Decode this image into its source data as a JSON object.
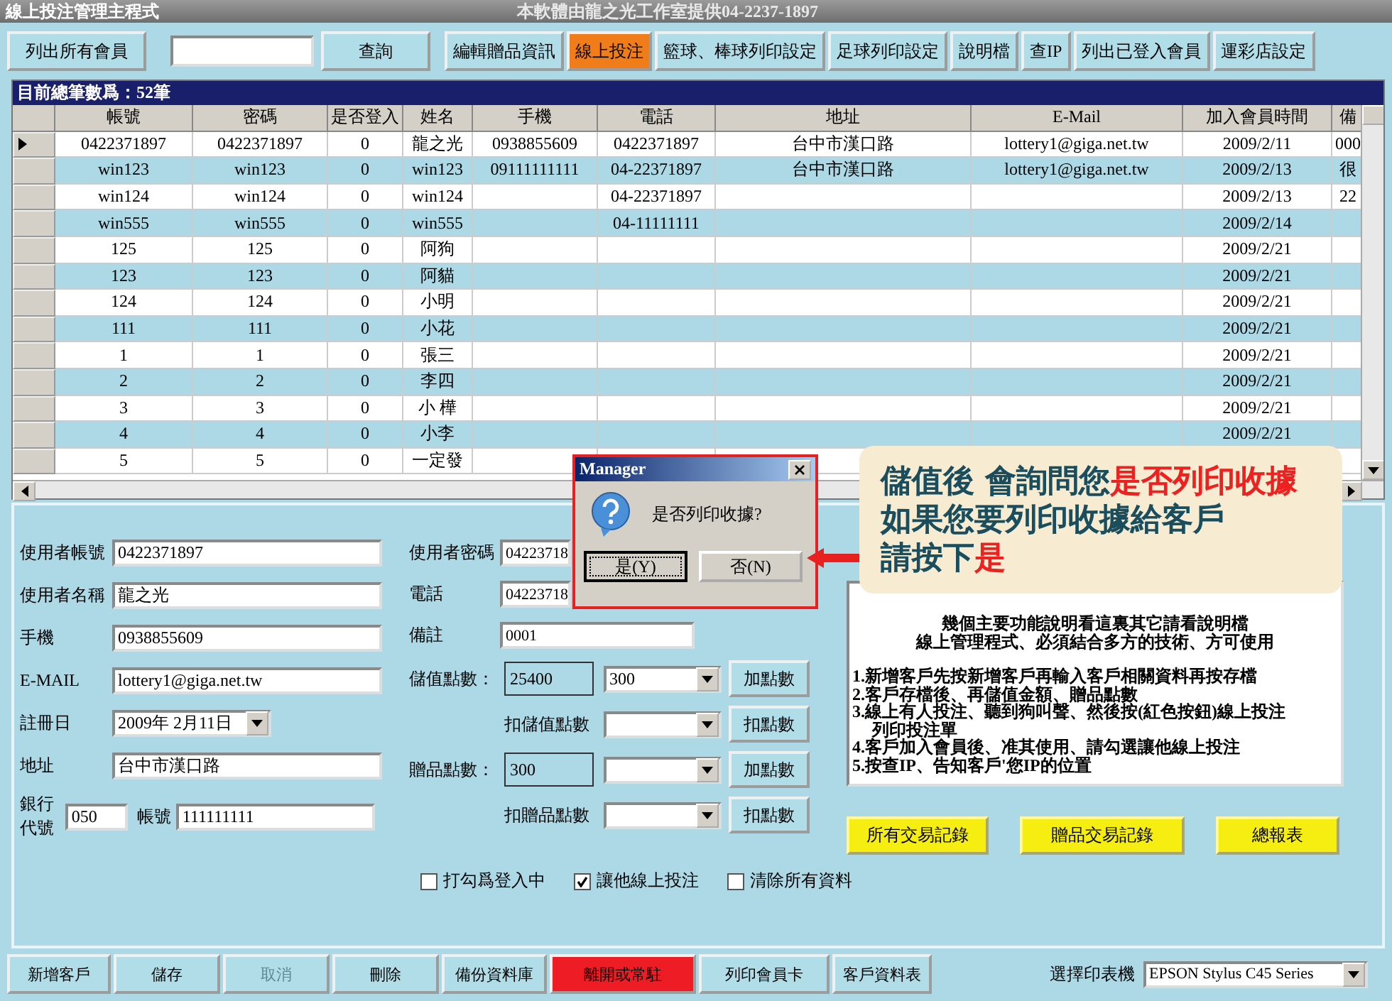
{
  "window": {
    "title": "線上投注管理主程式",
    "subtitle": "本軟體由龍之光工作室提供04-2237-1897"
  },
  "toolbar": {
    "left_button": "列出所有會員",
    "search_button": "查詢",
    "buttons": [
      {
        "label": "編輯贈品資訊",
        "highlight": false
      },
      {
        "label": "線上投注",
        "highlight": true
      },
      {
        "label": "籃球、棒球列印設定",
        "highlight": false
      },
      {
        "label": "足球列印設定",
        "highlight": false
      },
      {
        "label": "說明檔",
        "highlight": false
      },
      {
        "label": "查IP",
        "highlight": false
      },
      {
        "label": "列出已登入會員",
        "highlight": false
      },
      {
        "label": "運彩店設定",
        "highlight": false
      }
    ]
  },
  "table": {
    "caption": "目前總筆數爲：52筆",
    "columns": [
      "帳號",
      "密碼",
      "是否登入",
      "姓名",
      "手機",
      "電話",
      "地址",
      "E-Mail",
      "加入會員時間",
      "備"
    ],
    "rows": [
      {
        "selected": true,
        "cells": [
          "0422371897",
          "0422371897",
          "0",
          "龍之光",
          "0938855609",
          "0422371897",
          "台中市漢口路",
          "lottery1@giga.net.tw",
          "2009/2/11",
          "000"
        ]
      },
      {
        "selected": false,
        "cells": [
          "win123",
          "win123",
          "0",
          "win123",
          "09111111111",
          "04-22371897",
          "台中市漢口路",
          "lottery1@giga.net.tw",
          "2009/2/13",
          "很"
        ]
      },
      {
        "selected": false,
        "cells": [
          "win124",
          "win124",
          "0",
          "win124",
          "",
          "04-22371897",
          "",
          "",
          "2009/2/13",
          "22"
        ]
      },
      {
        "selected": false,
        "cells": [
          "win555",
          "win555",
          "0",
          "win555",
          "",
          "04-11111111",
          "",
          "",
          "2009/2/14",
          ""
        ]
      },
      {
        "selected": false,
        "cells": [
          "125",
          "125",
          "0",
          "阿狗",
          "",
          "",
          "",
          "",
          "2009/2/21",
          ""
        ]
      },
      {
        "selected": false,
        "cells": [
          "123",
          "123",
          "0",
          "阿貓",
          "",
          "",
          "",
          "",
          "2009/2/21",
          ""
        ]
      },
      {
        "selected": false,
        "cells": [
          "124",
          "124",
          "0",
          "小明",
          "",
          "",
          "",
          "",
          "2009/2/21",
          ""
        ]
      },
      {
        "selected": false,
        "cells": [
          "111",
          "111",
          "0",
          "小花",
          "",
          "",
          "",
          "",
          "2009/2/21",
          ""
        ]
      },
      {
        "selected": false,
        "cells": [
          "1",
          "1",
          "0",
          "張三",
          "",
          "",
          "",
          "",
          "2009/2/21",
          ""
        ]
      },
      {
        "selected": false,
        "cells": [
          "2",
          "2",
          "0",
          "李四",
          "",
          "",
          "",
          "",
          "2009/2/21",
          ""
        ]
      },
      {
        "selected": false,
        "cells": [
          "3",
          "3",
          "0",
          "小 樺",
          "",
          "",
          "",
          "",
          "2009/2/21",
          ""
        ]
      },
      {
        "selected": false,
        "cells": [
          "4",
          "4",
          "0",
          "小李",
          "",
          "",
          "",
          "",
          "2009/2/21",
          ""
        ]
      },
      {
        "selected": false,
        "cells": [
          "5",
          "5",
          "0",
          "一定發",
          "",
          "",
          "",
          "",
          "",
          ""
        ]
      }
    ]
  },
  "form": {
    "left_fields": [
      {
        "label": "使用者帳號",
        "value": "0422371897",
        "kind": "text"
      },
      {
        "label": "使用者名稱",
        "value": "龍之光",
        "kind": "text"
      },
      {
        "label": "手機",
        "value": "0938855609",
        "kind": "text"
      },
      {
        "label": "E-MAIL",
        "value": "lottery1@giga.net.tw",
        "kind": "text"
      },
      {
        "label": "註冊日",
        "value": "2009年  2月11日",
        "kind": "date"
      },
      {
        "label": "地址",
        "value": "台中市漢口路",
        "kind": "text"
      }
    ],
    "bank": {
      "label": "銀行代號",
      "code": "050",
      "account_label": "帳號",
      "account": "111111111"
    },
    "right_fields": [
      {
        "label": "使用者密碼",
        "value": "04223718"
      },
      {
        "label": "電話",
        "value": "04223718"
      },
      {
        "label": "備註",
        "value": "0001"
      }
    ],
    "points": [
      {
        "label": "儲值點數：",
        "value": "25400",
        "select": "300",
        "button": "加點數",
        "kind": "balance"
      },
      {
        "label": "扣儲值點數",
        "button": "扣點數",
        "kind": "deduct"
      },
      {
        "label": "贈品點數：",
        "value": "300",
        "button": "加點數",
        "kind": "balance"
      },
      {
        "label": "扣贈品點數",
        "button": "扣點數",
        "kind": "deduct"
      }
    ],
    "info_lines": [
      {
        "text": "幾個主要功能說明看這裏其它請看說明檔",
        "kind": "center"
      },
      {
        "text": "線上管理程式、必須結合多方的技術、方可使用",
        "kind": "center"
      },
      {
        "text": "1.新增客戶先按新增客戶再輸入客戶相關資料再按存檔",
        "kind": "item"
      },
      {
        "text": "2.客戶存檔後、再儲值金額、贈品點數",
        "kind": "item"
      },
      {
        "text": "3.線上有人投注、聽到狗叫聲、然後按(紅色按鈕)線上投注",
        "kind": "item"
      },
      {
        "text": "列印投注單",
        "kind": "indent"
      },
      {
        "text": "4.客戶加入會員後、准其使用、請勾選讓他線上投注",
        "kind": "item"
      },
      {
        "text": "5.按查IP、告知客戶'您IP的位置",
        "kind": "item"
      }
    ],
    "report_buttons": [
      "所有交易記錄",
      "贈品交易記錄",
      "總報表"
    ],
    "checkboxes": [
      {
        "label": "打勾爲登入中",
        "checked": false
      },
      {
        "label": "讓他線上投注",
        "checked": true
      },
      {
        "label": "清除所有資料",
        "checked": false
      }
    ]
  },
  "bottom_bar": {
    "buttons": [
      {
        "label": "新增客戶",
        "disabled": false,
        "danger": false
      },
      {
        "label": "儲存",
        "disabled": false,
        "danger": false
      },
      {
        "label": "取消",
        "disabled": true,
        "danger": false
      },
      {
        "label": "刪除",
        "disabled": false,
        "danger": false
      },
      {
        "label": "備份資料庫",
        "disabled": false,
        "danger": false
      },
      {
        "label": "離開或常駐",
        "disabled": false,
        "danger": true
      },
      {
        "label": "列印會員卡",
        "disabled": false,
        "danger": false
      },
      {
        "label": "客戶資料表",
        "disabled": false,
        "danger": false
      }
    ],
    "printer_label": "選擇印表機",
    "printer": "EPSON Stylus C45 Series"
  },
  "dialog": {
    "title": "Manager",
    "message": "是否列印收據?",
    "buttons": [
      {
        "label": "是(Y)",
        "focused": true
      },
      {
        "label": "否(N)",
        "focused": false
      }
    ]
  },
  "callout": {
    "lines": [
      [
        {
          "text": "儲值後  會詢問您",
          "emphasis": false
        },
        {
          "text": "是否列印收據",
          "emphasis": true
        }
      ],
      [
        {
          "text": "如果您要列印收據給客戶",
          "emphasis": false
        }
      ],
      [
        {
          "text": "請按下",
          "emphasis": false
        },
        {
          "text": "是",
          "emphasis": true
        }
      ]
    ]
  }
}
